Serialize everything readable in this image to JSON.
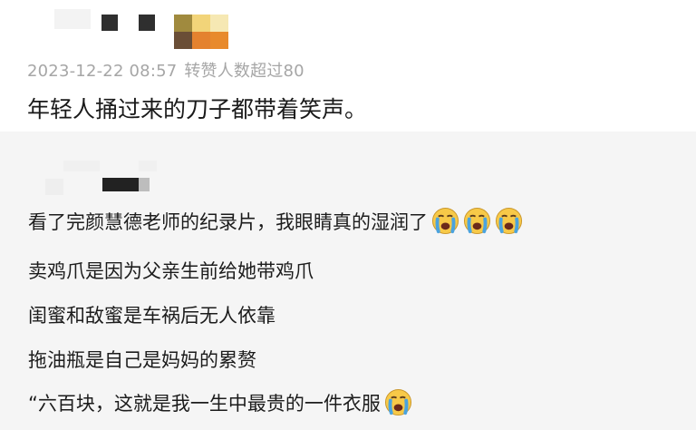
{
  "comment": {
    "date": "2023-12-22 08:57",
    "likes": "转赞人数超过80",
    "text": "年轻人捅过来的刀子都带着笑声。"
  },
  "reply": {
    "lines": [
      "看了完颜慧德老师的纪录片，我眼睛真的湿润了",
      "卖鸡爪是因为父亲生前给她带鸡爪",
      "闺蜜和敌蜜是车祸后无人依靠",
      "拖油瓶是自己是妈妈的累赘",
      "“六百块，这就是我一生中最贵的一件衣服"
    ],
    "emoji": "crying-face-icon"
  },
  "colors": {
    "meta_text": "#a6a6a6",
    "main_text": "#1a1a1a",
    "reply_bg": "#f5f5f5",
    "emoji_face": "#f7c948",
    "emoji_tear": "#4aa3df"
  }
}
